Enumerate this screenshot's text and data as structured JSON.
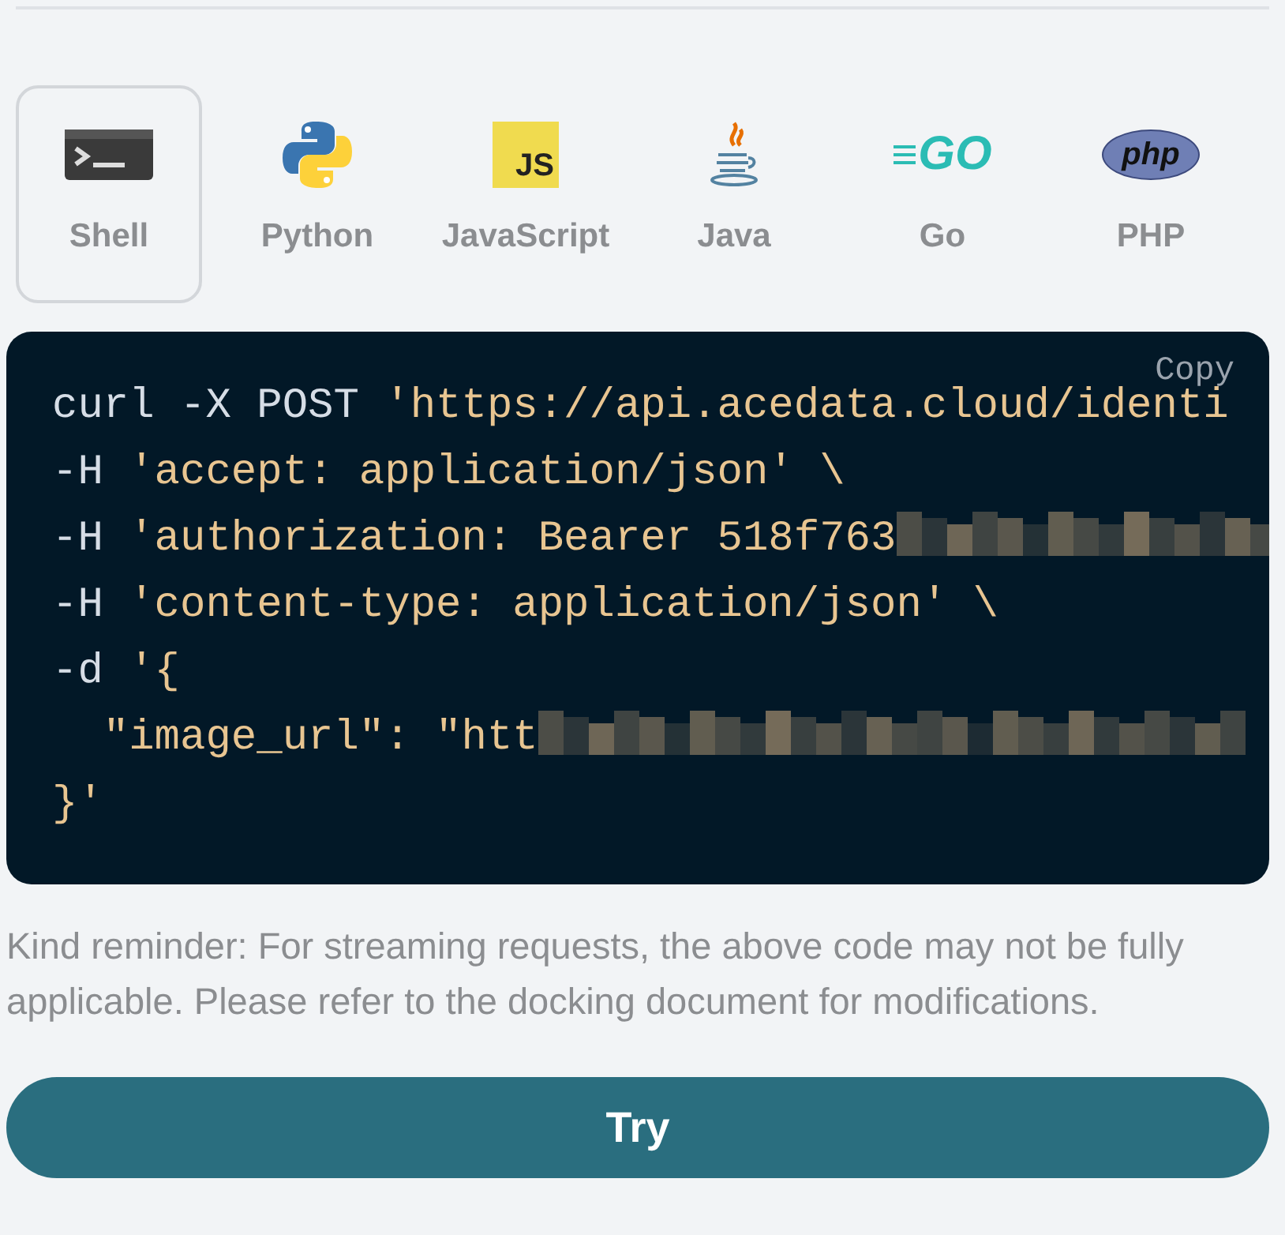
{
  "languages": [
    {
      "label": "Shell",
      "kind": "shell",
      "selected": true
    },
    {
      "label": "Python",
      "kind": "python",
      "selected": false
    },
    {
      "label": "JavaScript",
      "kind": "js",
      "logo_text": "JS",
      "selected": false
    },
    {
      "label": "Java",
      "kind": "java",
      "selected": false
    },
    {
      "label": "Go",
      "kind": "go",
      "logo_text": "GO",
      "selected": false
    },
    {
      "label": "PHP",
      "kind": "php",
      "logo_text": "php",
      "selected": false
    }
  ],
  "code": {
    "copy_label": "Copy",
    "lines": [
      {
        "parts": [
          {
            "kind": "plain",
            "text": "curl -X POST "
          },
          {
            "kind": "string",
            "text": "'https://api.acedata.cloud/identi"
          }
        ],
        "redacted": false
      },
      {
        "parts": [
          {
            "kind": "plain",
            "text": "-H "
          },
          {
            "kind": "string",
            "text": "'accept: application/json' \\"
          }
        ],
        "redacted": false
      },
      {
        "parts": [
          {
            "kind": "plain",
            "text": "-H "
          },
          {
            "kind": "string",
            "text": "'authorization: Bearer 518f763"
          }
        ],
        "redacted": true
      },
      {
        "parts": [
          {
            "kind": "plain",
            "text": "-H "
          },
          {
            "kind": "string",
            "text": "'content-type: application/json' \\"
          }
        ],
        "redacted": false
      },
      {
        "parts": [
          {
            "kind": "plain",
            "text": "-d "
          },
          {
            "kind": "string",
            "text": "'{"
          }
        ],
        "redacted": false
      },
      {
        "parts": [
          {
            "kind": "string",
            "text": "  \"image_url\": \"htt"
          }
        ],
        "redacted": true
      },
      {
        "parts": [
          {
            "kind": "string",
            "text": "}'"
          }
        ],
        "redacted": false
      }
    ]
  },
  "reminder": "Kind reminder: For streaming requests, the above code may not be fully applicable. Please refer to the docking document for modifications.",
  "try_button": "Try"
}
